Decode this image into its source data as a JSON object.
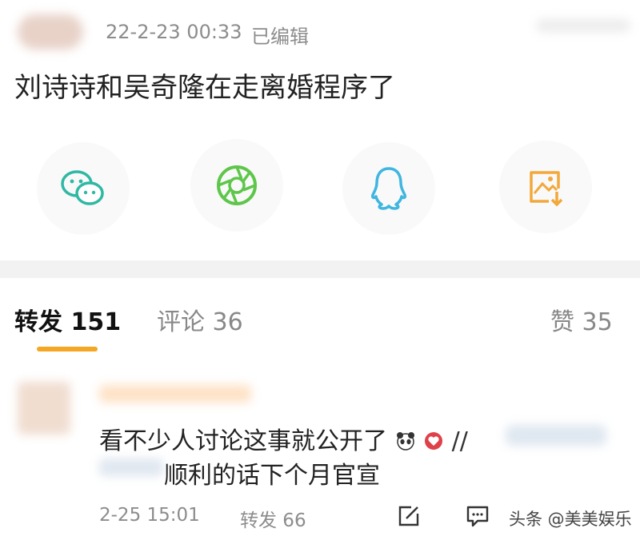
{
  "post": {
    "timestamp": "22-2-23 00:33",
    "edited_label": "已编辑",
    "text": "刘诗诗和吴奇隆在走离婚程序了"
  },
  "share": {
    "items": [
      {
        "icon": "wechat-icon",
        "color": "#2fb8a4"
      },
      {
        "icon": "moments-icon",
        "color": "#5ec64a"
      },
      {
        "icon": "qq-icon",
        "color": "#3fb6e0"
      },
      {
        "icon": "save-image-icon",
        "color": "#f2a83a"
      }
    ]
  },
  "tabs": {
    "repost_label": "转发 151",
    "comment_label": "评论 36",
    "like_label": "赞 35",
    "active_color": "#f5a623"
  },
  "repost": {
    "text_line1": "看不少人讨论这事就公开了",
    "text_line2": "顺利的话下个月官宣",
    "separator": "//",
    "time": "2-25 15:01",
    "repost_count_label": "转发 66"
  },
  "watermark": {
    "text": "头条 @美美娱乐"
  }
}
